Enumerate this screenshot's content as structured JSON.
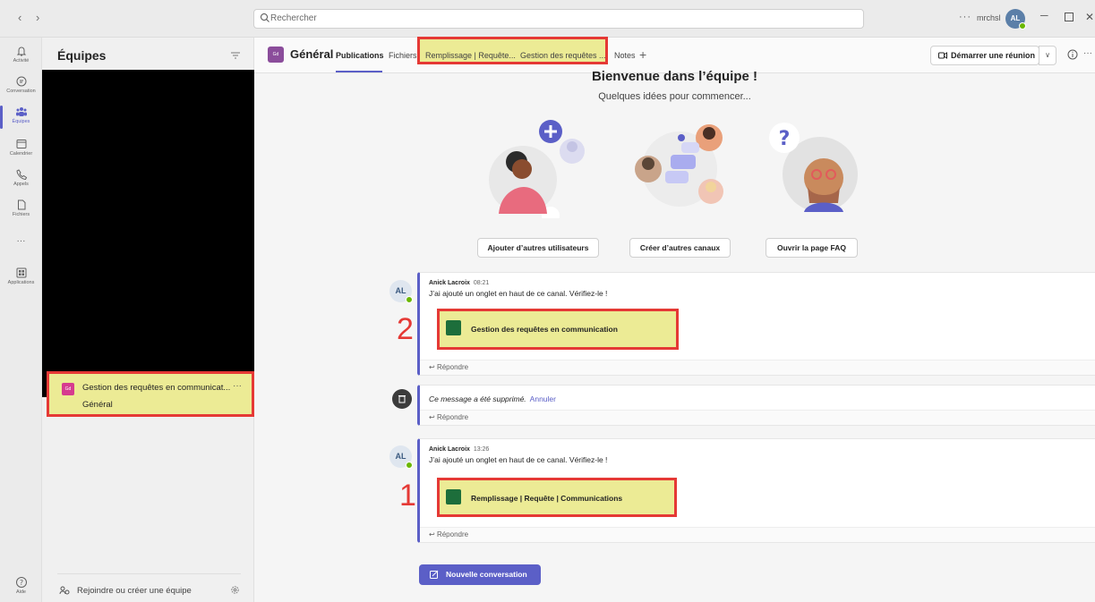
{
  "titlebar": {
    "nav_arrows": "‹ ›",
    "search_placeholder": "Rechercher",
    "more": "···",
    "user_name": "mrchsl",
    "avatar_initials": "AL",
    "minimize": "─",
    "close": "✕"
  },
  "appbar": {
    "items": [
      {
        "label": "Activité",
        "icon": "bell-icon"
      },
      {
        "label": "Conversation",
        "icon": "chat-icon"
      },
      {
        "label": "Équipes",
        "icon": "teams-icon"
      },
      {
        "label": "Calendrier",
        "icon": "calendar-icon"
      },
      {
        "label": "Appels",
        "icon": "phone-icon"
      },
      {
        "label": "Fichiers",
        "icon": "file-icon"
      },
      {
        "label": "···",
        "icon": "more-icon"
      },
      {
        "label": "Applications",
        "icon": "apps-icon"
      }
    ],
    "help_label": "Aide"
  },
  "teams_panel": {
    "title": "Équipes",
    "team_name": "Gestion des requêtes en communicat...",
    "team_initials": "Gd",
    "team_more": "···",
    "channel": "Général",
    "join_label": "Rejoindre ou créer une équipe"
  },
  "channel_header": {
    "avatar_initials": "Gd",
    "title": "Général",
    "tabs": [
      "Publications",
      "Fichiers",
      "Remplissage | Requête...",
      "Gestion des requêtes ...",
      "Notes"
    ],
    "add_tab": "+",
    "meet_label": "Démarrer une réunion",
    "meet_dropdown": "∨",
    "more": "···"
  },
  "welcome": {
    "title": "Bienvenue dans l’équipe !",
    "subtitle": "Quelques idées pour commencer...",
    "buttons": [
      "Ajouter d’autres utilisateurs",
      "Créer d’autres canaux",
      "Ouvrir la page FAQ"
    ]
  },
  "messages": [
    {
      "author": "Anick Lacroix",
      "time": "08:21",
      "avatar": "AL",
      "text": "J’ai ajouté un onglet en haut de ce canal. Vérifiez-le !",
      "tab_card": "Gestion des requêtes en communication",
      "marker": "2",
      "reply": "Répondre"
    },
    {
      "deleted_text": "Ce message a été supprimé.",
      "undo": "Annuler",
      "reply": "Répondre"
    },
    {
      "author": "Anick Lacroix",
      "time": "13:26",
      "avatar": "AL",
      "text": "J’ai ajouté un onglet en haut de ce canal. Vérifiez-le !",
      "tab_card": "Remplissage | Requête | Communications",
      "marker": "1",
      "reply": "Répondre"
    }
  ],
  "new_conversation": "Nouvelle conversation",
  "colors": {
    "accent": "#5b5fc7",
    "highlight": "#eceb95",
    "annotation": "#e53935"
  }
}
